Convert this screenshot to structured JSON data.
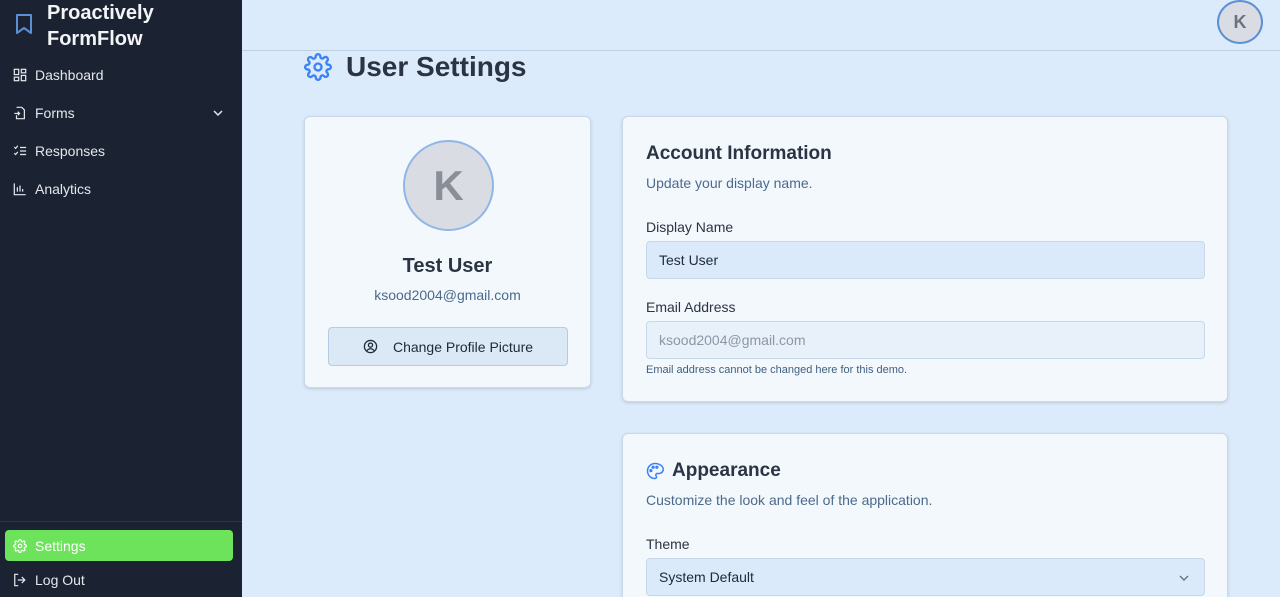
{
  "app": {
    "brand_line1": "Proactively",
    "brand_line2": "FormFlow"
  },
  "sidebar": {
    "items": [
      {
        "label": "Dashboard",
        "icon": "dashboard-grid-icon"
      },
      {
        "label": "Forms",
        "icon": "file-import-icon",
        "has_chevron": true
      },
      {
        "label": "Responses",
        "icon": "list-checks-icon"
      },
      {
        "label": "Analytics",
        "icon": "bar-chart-icon"
      }
    ],
    "settings_label": "Settings",
    "logout_label": "Log Out",
    "active_color": "#6ce35a"
  },
  "header": {
    "avatar_initial": "K"
  },
  "page": {
    "title": "User Settings",
    "title_icon": "gear-icon",
    "accent_color": "#3b82f6"
  },
  "profile": {
    "initial": "K",
    "name": "Test User",
    "email": "ksood2004@gmail.com",
    "change_picture_label": "Change Profile Picture"
  },
  "account": {
    "title": "Account Information",
    "subtitle": "Update your display name.",
    "display_name_label": "Display Name",
    "display_name_value": "Test User",
    "email_label": "Email Address",
    "email_value": "ksood2004@gmail.com",
    "email_help": "Email address cannot be changed here for this demo."
  },
  "appearance": {
    "title": "Appearance",
    "subtitle": "Customize the look and feel of the application.",
    "theme_label": "Theme",
    "theme_value": "System Default"
  }
}
